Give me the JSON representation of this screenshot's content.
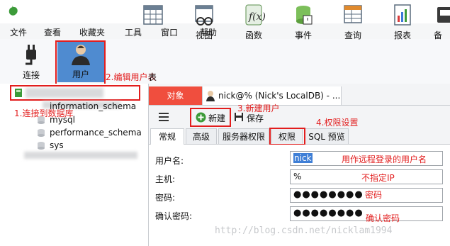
{
  "menu": {
    "items": [
      "文件",
      "查看",
      "收藏夹",
      "工具",
      "窗口",
      "帮助"
    ]
  },
  "toolbar": {
    "tools": [
      {
        "label": "连接",
        "icon": "plug-icon"
      },
      {
        "label": "用户",
        "icon": "user-icon"
      },
      {
        "label": "表",
        "icon": "table-icon"
      },
      {
        "label": "视图",
        "icon": "view-icon"
      },
      {
        "label": "函数",
        "icon": "function-icon"
      },
      {
        "label": "事件",
        "icon": "event-icon"
      },
      {
        "label": "查询",
        "icon": "query-icon"
      },
      {
        "label": "报表",
        "icon": "report-icon"
      },
      {
        "label": "备",
        "icon": "backup-icon"
      }
    ]
  },
  "sidebar": {
    "databases": [
      "information_schema",
      "mysql",
      "performance_schema",
      "sys"
    ]
  },
  "editor": {
    "object_tab": "对象",
    "doc_tab_title": "nick@% (Nick's LocalDB) - ...",
    "new_label": "新建",
    "save_label": "保存",
    "tabs": [
      "常规",
      "高级",
      "服务器权限",
      "权限",
      "SQL 预览"
    ],
    "fields": [
      {
        "label": "用户名:",
        "value": "nick"
      },
      {
        "label": "主机:",
        "value": "%"
      },
      {
        "label": "密码:",
        "value": "●●●●●●●●"
      },
      {
        "label": "确认密码:",
        "value": "●●●●●●●●"
      }
    ]
  },
  "annotations": {
    "a1": "1.连接到数据库",
    "a2": "2.编辑用户表",
    "a3": "3.新建用户",
    "a4": "4.权限设置",
    "username_note": "用作远程登录的用户名",
    "host_note": "不指定IP",
    "password_note": "密码",
    "confirm_note": "确认密码"
  },
  "watermark": "http://blog.csdn.net/nicklam1994",
  "colors": {
    "accent_red": "#e21d1d",
    "object_tab": "#f04e3e",
    "selected_tool": "#4f8bd0"
  }
}
